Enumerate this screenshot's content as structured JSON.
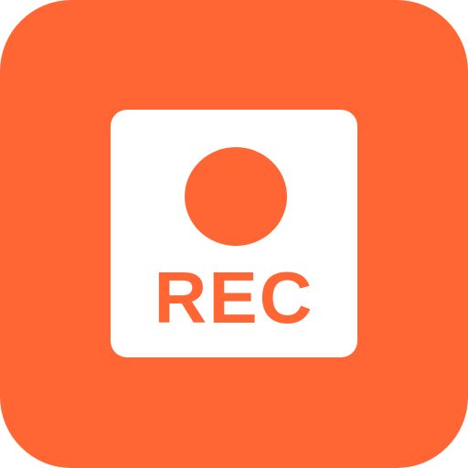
{
  "icon": {
    "label": "REC",
    "symbol": "record-dot",
    "colors": {
      "background": "#ff6633",
      "card": "#ffffff",
      "accent": "#ff6633"
    }
  }
}
